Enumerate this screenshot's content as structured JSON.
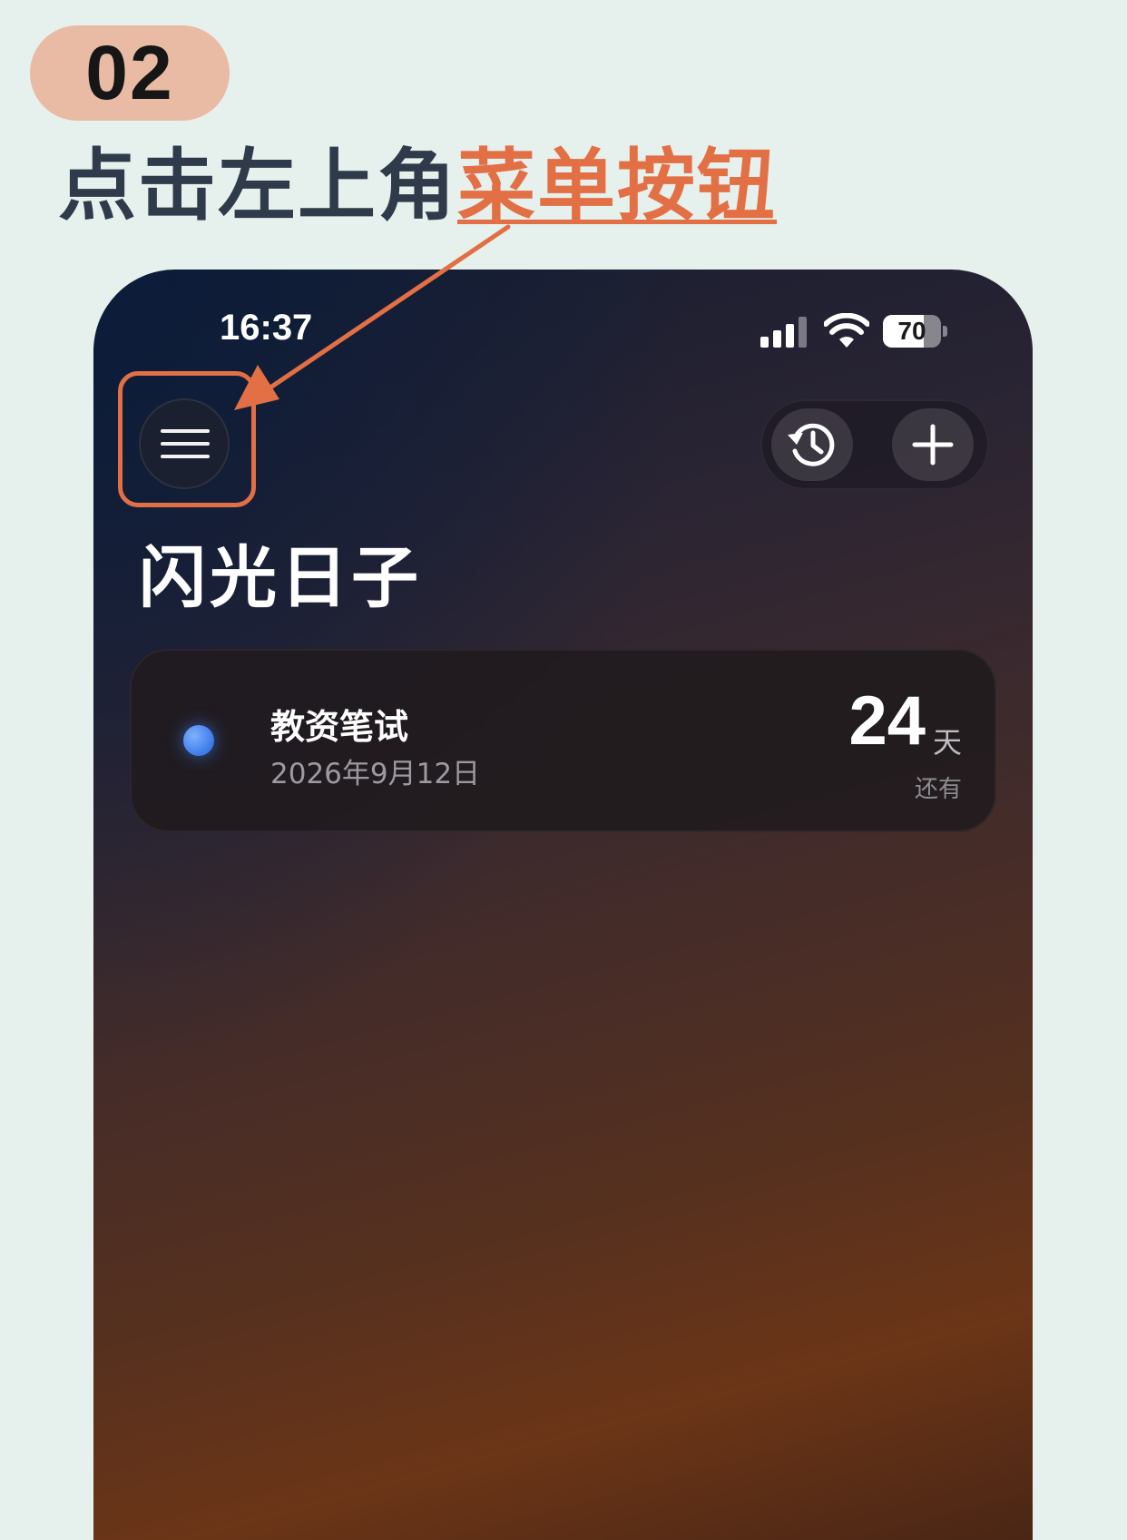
{
  "step": {
    "number": "02"
  },
  "headline": {
    "prefix": "点击左上角",
    "accent": "菜单按钮"
  },
  "status_bar": {
    "time": "16:37",
    "battery": "70",
    "battery_level": 0.7
  },
  "toolbar": {
    "menu_icon": "hamburger-menu-icon",
    "history_icon": "history-clock-icon",
    "add_icon": "plus-icon"
  },
  "app": {
    "title": "闪光日子"
  },
  "events": [
    {
      "name": "教资笔试",
      "date": "2026年9月12日",
      "count": "24",
      "unit": "天",
      "label": "还有",
      "dot_color": "#3b7be8"
    }
  ],
  "colors": {
    "accent": "#e36f45",
    "badge": "#e9bba4",
    "background": "#e6f0ec"
  }
}
